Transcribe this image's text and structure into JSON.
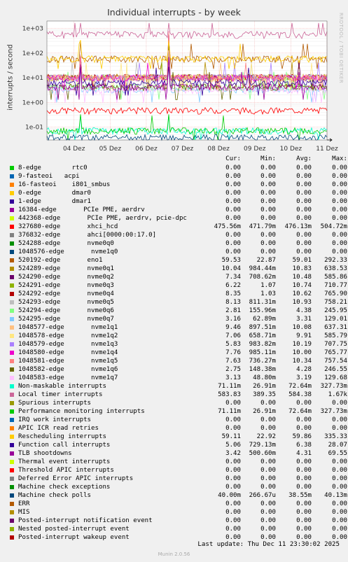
{
  "title": "Individual interrupts - by week",
  "watermark": "RRDTOOL / TOBI OETIKER",
  "footer": {
    "last_update": "Last update: Thu Dec 11 23:30:02 2025",
    "generator": "Munin 2.0.56"
  },
  "chart_data": {
    "type": "line",
    "title": "Individual interrupts - by week",
    "ylabel": "interrupts / second",
    "yscale": "log",
    "ylim": [
      0.03,
      2000
    ],
    "yticks": [
      "1e+03",
      "1e+02",
      "1e+01",
      "1e+00",
      "1e-01"
    ],
    "ytick_values": [
      1000,
      100,
      10,
      1,
      0.1
    ],
    "xticks": [
      "04 Dez",
      "05 Dez",
      "06 Dez",
      "07 Dez",
      "08 Dez",
      "09 Dez",
      "10 Dez",
      "11 Dez"
    ],
    "grid": true,
    "columns": [
      "Cur:",
      "Min:",
      "Avg:",
      "Max:"
    ],
    "series": [
      {
        "name": "8-edge        rtc0",
        "color": "#00cc00",
        "cur": "0.00",
        "min": "0.00",
        "avg": "0.00",
        "max": "0.00"
      },
      {
        "name": "9-fasteoi   acpi",
        "color": "#0066b3",
        "cur": "0.00",
        "min": "0.00",
        "avg": "0.00",
        "max": "0.00"
      },
      {
        "name": "16-fasteoi    i801_smbus",
        "color": "#ff8000",
        "cur": "0.00",
        "min": "0.00",
        "avg": "0.00",
        "max": "0.00"
      },
      {
        "name": "0-edge        dmar0",
        "color": "#ffcc00",
        "cur": "0.00",
        "min": "0.00",
        "avg": "0.00",
        "max": "0.00"
      },
      {
        "name": "1-edge        dmar1",
        "color": "#330099",
        "cur": "0.00",
        "min": "0.00",
        "avg": "0.00",
        "max": "0.00"
      },
      {
        "name": "16384-edge       PCIe PME, aerdrv",
        "color": "#990099",
        "cur": "0.00",
        "min": "0.00",
        "avg": "0.00",
        "max": "0.00"
      },
      {
        "name": "442368-edge       PCIe PME, aerdrv, pcie-dpc",
        "color": "#ccff00",
        "cur": "0.00",
        "min": "0.00",
        "avg": "0.00",
        "max": "0.00"
      },
      {
        "name": "327680-edge       xhci_hcd",
        "color": "#ff0000",
        "cur": "475.56m",
        "min": "471.79m",
        "avg": "476.13m",
        "max": "504.72m"
      },
      {
        "name": "376832-edge       ahci[0000:00:17.0]",
        "color": "#808080",
        "cur": "0.00",
        "min": "0.00",
        "avg": "0.00",
        "max": "0.00"
      },
      {
        "name": "524288-edge       nvme0q0",
        "color": "#008f00",
        "cur": "0.00",
        "min": "0.00",
        "avg": "0.00",
        "max": "0.00"
      },
      {
        "name": "1048576-edge       nvme1q0",
        "color": "#00487d",
        "cur": "0.00",
        "min": "0.00",
        "avg": "0.00",
        "max": "0.00"
      },
      {
        "name": "520192-edge       eno1",
        "color": "#b35a00",
        "cur": "59.53",
        "min": "22.87",
        "avg": "59.01",
        "max": "292.33"
      },
      {
        "name": "524289-edge       nvme0q1",
        "color": "#b38f00",
        "cur": "10.04",
        "min": "984.44m",
        "avg": "10.83",
        "max": "638.53"
      },
      {
        "name": "524290-edge       nvme0q2",
        "color": "#6b006b",
        "cur": "7.34",
        "min": "708.62m",
        "avg": "10.48",
        "max": "585.86"
      },
      {
        "name": "524291-edge       nvme0q3",
        "color": "#8fb300",
        "cur": "6.22",
        "min": "1.07",
        "avg": "10.74",
        "max": "710.77"
      },
      {
        "name": "524292-edge       nvme0q4",
        "color": "#b30000",
        "cur": "8.35",
        "min": "1.03",
        "avg": "10.62",
        "max": "765.90"
      },
      {
        "name": "524293-edge       nvme0q5",
        "color": "#bebebe",
        "cur": "8.13",
        "min": "811.31m",
        "avg": "10.93",
        "max": "758.21"
      },
      {
        "name": "524294-edge       nvme0q6",
        "color": "#80ff80",
        "cur": "2.81",
        "min": "155.96m",
        "avg": "4.38",
        "max": "245.95"
      },
      {
        "name": "524295-edge       nvme0q7",
        "color": "#80c9ff",
        "cur": "3.16",
        "min": "62.89m",
        "avg": "3.31",
        "max": "129.01"
      },
      {
        "name": "1048577-edge       nvme1q1",
        "color": "#ffc080",
        "cur": "9.46",
        "min": "897.51m",
        "avg": "10.08",
        "max": "637.31"
      },
      {
        "name": "1048578-edge       nvme1q2",
        "color": "#ffe680",
        "cur": "7.06",
        "min": "658.71m",
        "avg": "9.91",
        "max": "585.79"
      },
      {
        "name": "1048579-edge       nvme1q3",
        "color": "#aa80ff",
        "cur": "5.83",
        "min": "983.82m",
        "avg": "10.19",
        "max": "707.75"
      },
      {
        "name": "1048580-edge       nvme1q4",
        "color": "#ee00cc",
        "cur": "7.76",
        "min": "985.11m",
        "avg": "10.00",
        "max": "765.77"
      },
      {
        "name": "1048581-edge       nvme1q5",
        "color": "#ff8080",
        "cur": "7.63",
        "min": "736.27m",
        "avg": "10.34",
        "max": "757.54"
      },
      {
        "name": "1048582-edge       nvme1q6",
        "color": "#666600",
        "cur": "2.75",
        "min": "148.38m",
        "avg": "4.28",
        "max": "246.55"
      },
      {
        "name": "1048583-edge       nvme1q7",
        "color": "#ffbfff",
        "cur": "3.13",
        "min": "48.80m",
        "avg": "3.19",
        "max": "129.68"
      },
      {
        "name": "Non-maskable interrupts",
        "color": "#00ffcc",
        "cur": "71.11m",
        "min": "26.91m",
        "avg": "72.64m",
        "max": "327.73m"
      },
      {
        "name": "Local timer interrupts",
        "color": "#cc6699",
        "cur": "583.83",
        "min": "389.35",
        "avg": "584.38",
        "max": "1.67k"
      },
      {
        "name": "Spurious interrupts",
        "color": "#999900",
        "cur": "0.00",
        "min": "0.00",
        "avg": "0.00",
        "max": "0.00"
      },
      {
        "name": "Performance monitoring interrupts",
        "color": "#00cc00",
        "cur": "71.11m",
        "min": "26.91m",
        "avg": "72.64m",
        "max": "327.73m"
      },
      {
        "name": "IRQ work interrupts",
        "color": "#0066b3",
        "cur": "0.00",
        "min": "0.00",
        "avg": "0.00",
        "max": "0.00"
      },
      {
        "name": "APIC ICR read retries",
        "color": "#ff8000",
        "cur": "0.00",
        "min": "0.00",
        "avg": "0.00",
        "max": "0.00"
      },
      {
        "name": "Rescheduling interrupts",
        "color": "#ffcc00",
        "cur": "59.11",
        "min": "22.92",
        "avg": "59.86",
        "max": "335.33"
      },
      {
        "name": "Function call interrupts",
        "color": "#330099",
        "cur": "5.06",
        "min": "729.13m",
        "avg": "6.38",
        "max": "28.07"
      },
      {
        "name": "TLB shootdowns",
        "color": "#990099",
        "cur": "3.42",
        "min": "500.60m",
        "avg": "4.31",
        "max": "69.55"
      },
      {
        "name": "Thermal event interrupts",
        "color": "#ccff00",
        "cur": "0.00",
        "min": "0.00",
        "avg": "0.00",
        "max": "0.00"
      },
      {
        "name": "Threshold APIC interrupts",
        "color": "#ff0000",
        "cur": "0.00",
        "min": "0.00",
        "avg": "0.00",
        "max": "0.00"
      },
      {
        "name": "Deferred Error APIC interrupts",
        "color": "#808080",
        "cur": "0.00",
        "min": "0.00",
        "avg": "0.00",
        "max": "0.00"
      },
      {
        "name": "Machine check exceptions",
        "color": "#008f00",
        "cur": "0.00",
        "min": "0.00",
        "avg": "0.00",
        "max": "0.00"
      },
      {
        "name": "Machine check polls",
        "color": "#00487d",
        "cur": "40.00m",
        "min": "266.67u",
        "avg": "38.55m",
        "max": "40.13m"
      },
      {
        "name": "ERR",
        "color": "#b35a00",
        "cur": "0.00",
        "min": "0.00",
        "avg": "0.00",
        "max": "0.00"
      },
      {
        "name": "MIS",
        "color": "#b38f00",
        "cur": "0.00",
        "min": "0.00",
        "avg": "0.00",
        "max": "0.00"
      },
      {
        "name": "Posted-interrupt notification event",
        "color": "#6b006b",
        "cur": "0.00",
        "min": "0.00",
        "avg": "0.00",
        "max": "0.00"
      },
      {
        "name": "Nested posted-interrupt event",
        "color": "#8fb300",
        "cur": "0.00",
        "min": "0.00",
        "avg": "0.00",
        "max": "0.00"
      },
      {
        "name": "Posted-interrupt wakeup event",
        "color": "#b30000",
        "cur": "0.00",
        "min": "0.00",
        "avg": "0.00",
        "max": "0.00"
      }
    ]
  }
}
